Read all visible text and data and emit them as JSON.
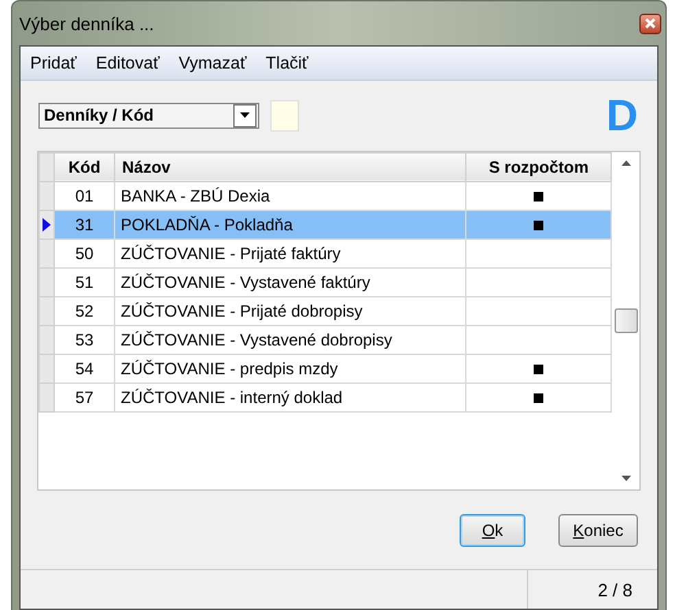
{
  "window": {
    "title": "Výber denníka ..."
  },
  "menu": [
    "Pridať",
    "Editovať",
    "Vymazať",
    "Tlačiť"
  ],
  "sort_combo": {
    "value": "Denníky / Kód"
  },
  "logo": "D",
  "table": {
    "columns": [
      "Kód",
      "Názov",
      "S rozpočtom"
    ],
    "rows": [
      {
        "code": "01",
        "name": "BANKA - ZBÚ Dexia",
        "budget": true,
        "selected": false
      },
      {
        "code": "31",
        "name": "POKLADŇA - Pokladňa",
        "budget": true,
        "selected": true
      },
      {
        "code": "50",
        "name": "ZÚČTOVANIE - Prijaté faktúry",
        "budget": false,
        "selected": false
      },
      {
        "code": "51",
        "name": "ZÚČTOVANIE - Vystavené faktúry",
        "budget": false,
        "selected": false
      },
      {
        "code": "52",
        "name": "ZÚČTOVANIE - Prijaté dobropisy",
        "budget": false,
        "selected": false
      },
      {
        "code": "53",
        "name": "ZÚČTOVANIE - Vystavené dobropisy",
        "budget": false,
        "selected": false
      },
      {
        "code": "54",
        "name": "ZÚČTOVANIE - predpis mzdy",
        "budget": true,
        "selected": false
      },
      {
        "code": "57",
        "name": "ZÚČTOVANIE - interný doklad",
        "budget": true,
        "selected": false
      }
    ]
  },
  "buttons": [
    {
      "label": "Ok",
      "default": true
    },
    {
      "label": "Koniec",
      "default": false
    }
  ],
  "status_bar": {
    "position": "2 / 8"
  }
}
